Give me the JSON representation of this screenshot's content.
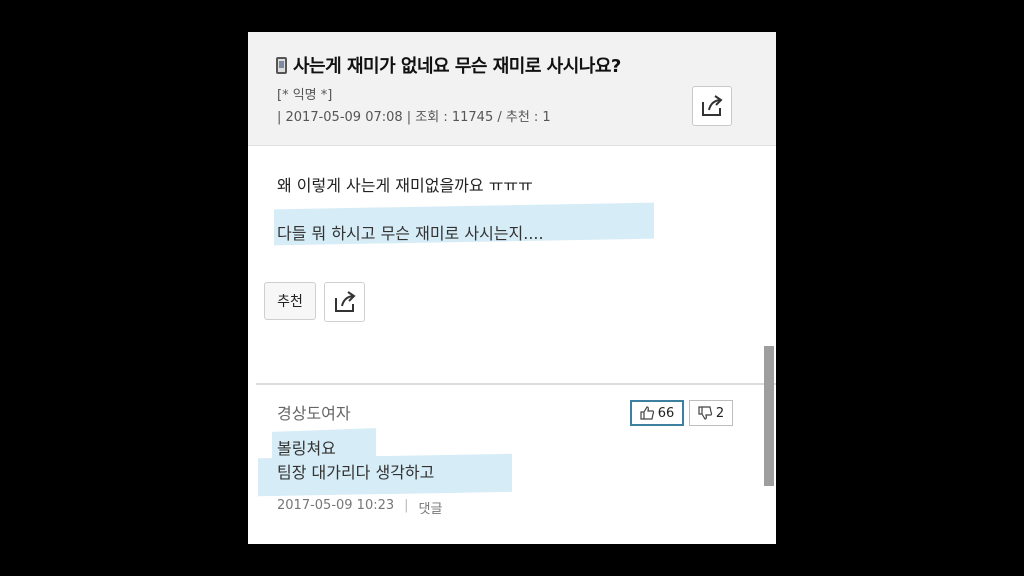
{
  "post": {
    "title": "사는게 재미가 없네요 무슨 재미로 사시나요?",
    "author": "[* 익명 *]",
    "meta": "| 2017-05-09 07:08 | 조회 : 11745 / 추천 : 1",
    "body_line1": "왜 이렇게 사는게 재미없을까요 ㅠㅠㅠ",
    "body_line2": "다들 뭐 하시고 무슨 재미로 사시는지....",
    "recommend_label": "추천"
  },
  "comment": {
    "author": "경상도여자",
    "likes": "66",
    "dislikes": "2",
    "line1": "볼링쳐요",
    "line2": "팀장 대가리다 생각하고",
    "timestamp": "2017-05-09 10:23",
    "separator": "|",
    "reply_label": "댓글"
  },
  "icons": {
    "title_icon": "mobile-phone-icon",
    "share": "share-icon",
    "like": "thumbs-up-icon",
    "dislike": "thumbs-down-icon"
  },
  "colors": {
    "highlight": "#d6ecf6",
    "like_border": "#3d7fa0"
  }
}
